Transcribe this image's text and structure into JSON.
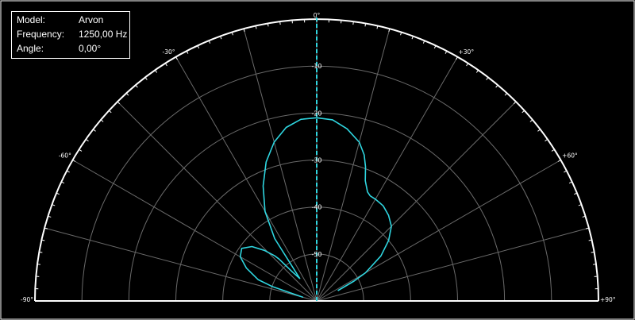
{
  "info": {
    "model_label": "Model:",
    "model_value": "Arvon",
    "frequency_label": "Frequency:",
    "frequency_value": "1250,00 Hz",
    "angle_label": "Angle:",
    "angle_value": "0,00°"
  },
  "colors": {
    "background": "#000000",
    "grid": "#6a6a6a",
    "outline": "#ffffff",
    "pattern": "#2fd6e0",
    "cursor": "#2fd6e0",
    "text": "#ffffff"
  },
  "chart_data": {
    "type": "line",
    "subtype": "polar-half",
    "title": "",
    "angle_range": [
      -90,
      90
    ],
    "angle_ticks": [
      -90,
      -60,
      -30,
      0,
      30,
      60,
      90
    ],
    "angle_tick_labels": [
      "-90°",
      "-60°",
      "-30°",
      "0°",
      "+30°",
      "+60°",
      "+90°"
    ],
    "radial_min": -60,
    "radial_max": 0,
    "radial_ticks": [
      -10,
      -20,
      -30,
      -40,
      -50
    ],
    "radial_tick_labels": [
      "-10",
      "-20",
      "-30",
      "-40",
      "-50"
    ],
    "grid": true,
    "cursor_angle": 0,
    "series": [
      {
        "angles": [
          -75,
          -72,
          -70,
          -65,
          -60,
          -55,
          -50,
          -46,
          -43,
          -42,
          -40,
          -37,
          -34,
          -30,
          -25,
          -20,
          -15,
          -10,
          -5,
          0,
          5,
          10,
          15,
          18,
          20,
          22,
          25,
          27,
          30,
          33,
          35,
          40,
          45,
          50,
          55,
          60,
          62,
          64
        ],
        "db": [
          -57,
          -50,
          -46.7,
          -43.5,
          -41.2,
          -40.5,
          -42,
          -44.5,
          -46.8,
          -48,
          -52,
          -54,
          -44,
          -38,
          -33,
          -28.5,
          -25,
          -22.5,
          -21.2,
          -21,
          -21.3,
          -22.8,
          -25,
          -27.3,
          -29.6,
          -32.4,
          -34.4,
          -34.9,
          -35,
          -35.2,
          -35.3,
          -36.2,
          -37.5,
          -40,
          -43.3,
          -48,
          -51,
          -55
        ]
      }
    ]
  }
}
